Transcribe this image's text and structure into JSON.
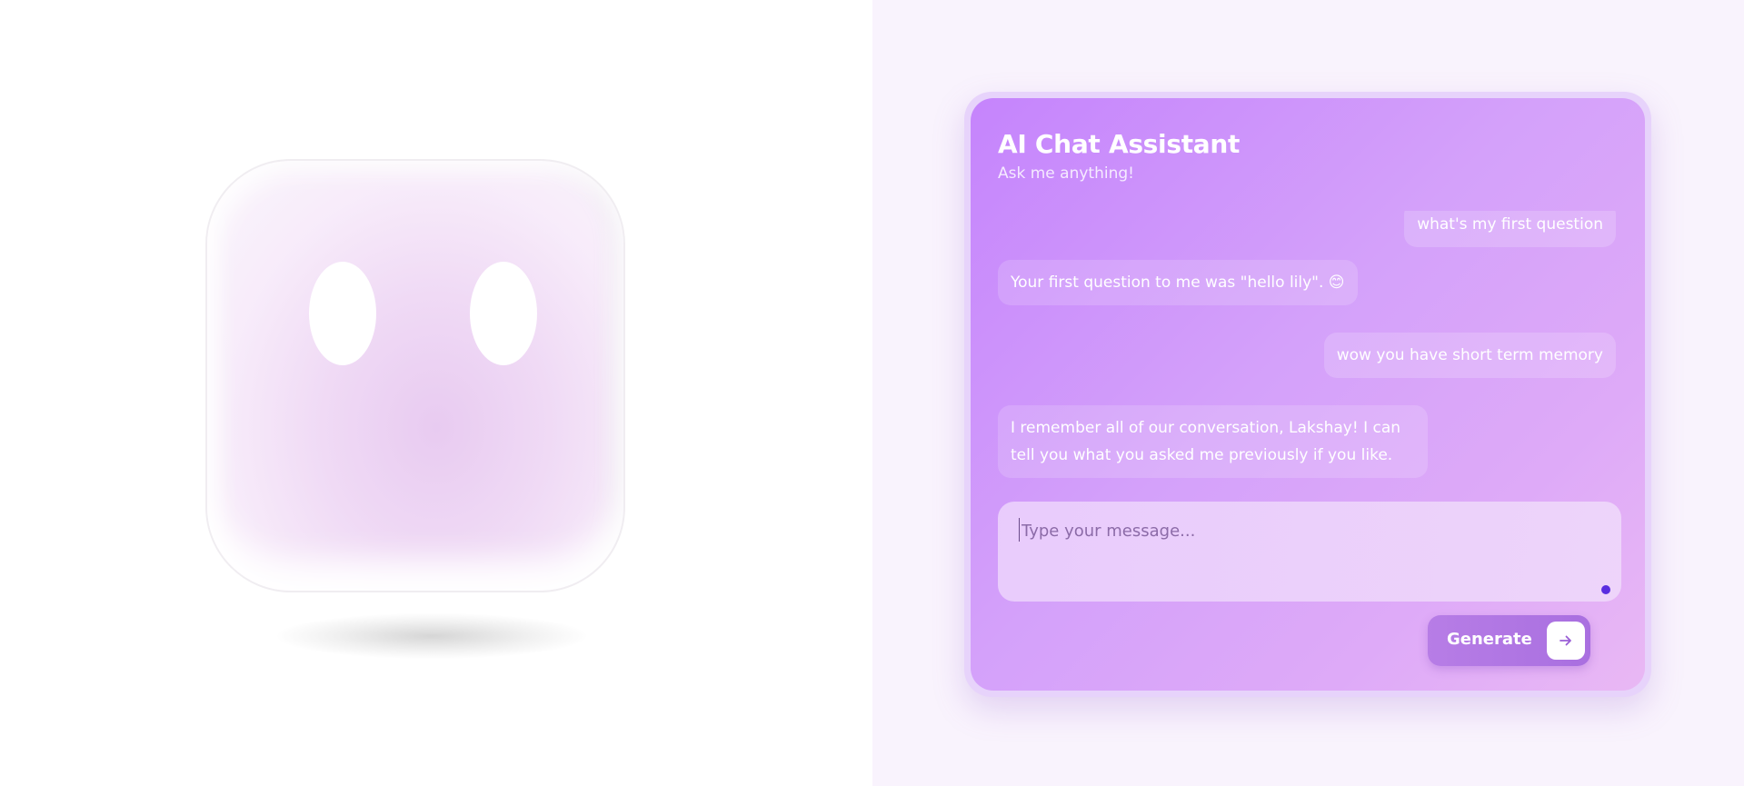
{
  "chat": {
    "title": "AI Chat Assistant",
    "subtitle": "Ask me anything!",
    "messages": [
      {
        "role": "user",
        "text": "what's my first question"
      },
      {
        "role": "assistant",
        "text": "Your first question to me was \"hello lily\". 😊"
      },
      {
        "role": "user",
        "text": "wow you have short term memory"
      },
      {
        "role": "assistant",
        "text": "I remember all of our conversation, Lakshay! I can tell you what you asked me previously if you like."
      }
    ],
    "input": {
      "placeholder": "Type your message...",
      "value": ""
    },
    "generate_label": "Generate",
    "generate_icon": "arrow-right-icon"
  },
  "colors": {
    "card_gradient_start": "#c584fc",
    "card_gradient_end": "#e9b8f4",
    "right_background": "#f9f3fd",
    "button": "#b07ae4",
    "indicator_dot": "#5a2de0"
  }
}
